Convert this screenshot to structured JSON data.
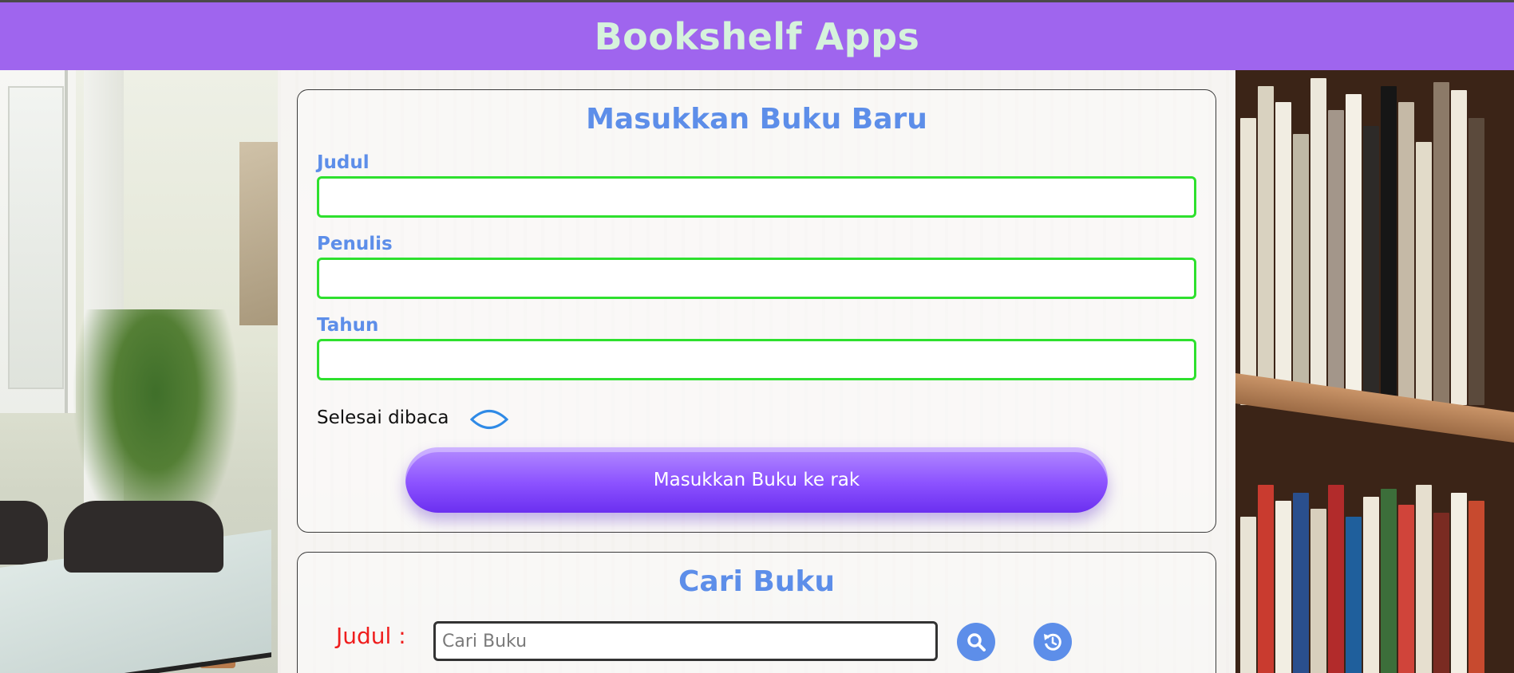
{
  "header": {
    "title": "Bookshelf Apps"
  },
  "add_form": {
    "title": "Masukkan Buku Baru",
    "fields": [
      {
        "label": "Judul",
        "value": ""
      },
      {
        "label": "Penulis",
        "value": ""
      },
      {
        "label": "Tahun",
        "value": ""
      }
    ],
    "checkbox_label": "Selesai dibaca",
    "checkbox_checked": false,
    "submit_label": "Masukkan Buku ke rak"
  },
  "search_form": {
    "title": "Cari Buku",
    "label": "Judul :",
    "placeholder": "Cari Buku",
    "search_icon": "search-icon",
    "reset_icon": "reset-icon"
  },
  "colors": {
    "header_bg": "#9f65ee",
    "title_text": "#d6f2dc",
    "accent_blue": "#5d8ee9",
    "input_border": "#2ee02e",
    "search_label": "#ef1d1d",
    "button_purple": "#8c52ff"
  }
}
